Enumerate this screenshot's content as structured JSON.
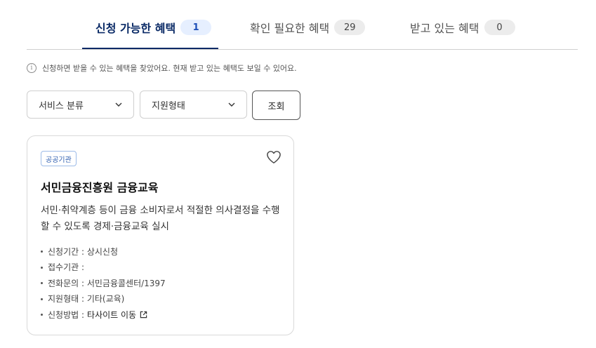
{
  "tabs": [
    {
      "label": "신청 가능한 혜택",
      "count": "1",
      "active": true
    },
    {
      "label": "확인 필요한 혜택",
      "count": "29",
      "active": false
    },
    {
      "label": "받고 있는 혜택",
      "count": "0",
      "active": false
    }
  ],
  "info": {
    "text": "신청하면 받을 수 있는 혜택을 찾았어요. 현재 받고 있는 혜택도 보일 수 있어요.",
    "icon": "info-icon"
  },
  "filters": {
    "category": {
      "value": "서비스 분류"
    },
    "support_type": {
      "value": "지원형태"
    },
    "search_label": "조회"
  },
  "card": {
    "tag": "공공기관",
    "title": "서민금융진흥원 금융교육",
    "description": "서민·취약계층 등이 금융 소비자로서 적절한 의사결정을 수행할 수 있도록 경제·금융교육 실시",
    "meta": {
      "period": "신청기간 : 상시신청",
      "office": "접수기관 : ",
      "phone": "전화문의 : 서민금융콜센터/1397",
      "type": "지원형태 : 기타(교육)",
      "method_label": "신청방법 : ",
      "method_link": "타사이트 이동"
    }
  },
  "colors": {
    "active_tab": "#0a2a66",
    "active_badge_bg": "#e6efff",
    "tag_border": "#9dbbe8"
  }
}
